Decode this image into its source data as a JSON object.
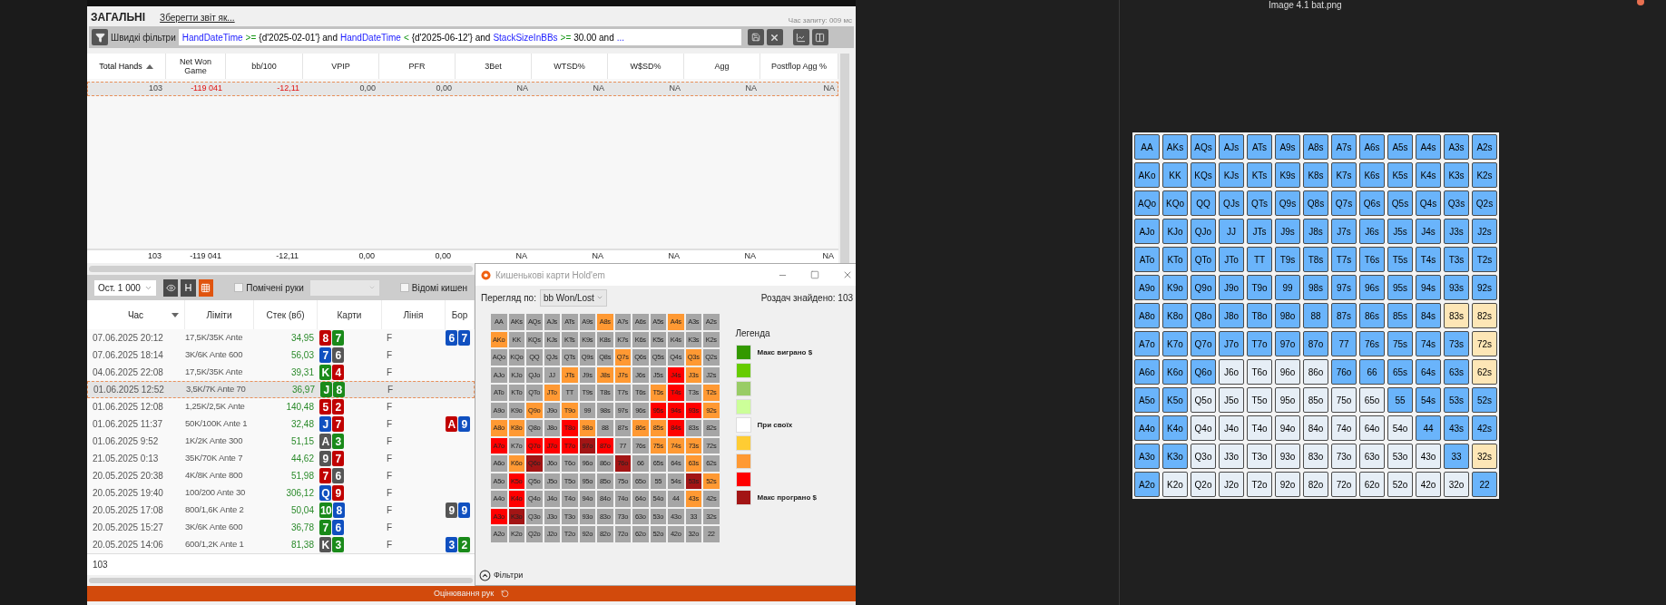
{
  "viewer": {
    "title": "Image 4.1 bat.png"
  },
  "report": {
    "title": "ЗАГАЛЬНІ",
    "save_link": "Зберегти звіт як...",
    "query_time": "Час запиту: 009 мс",
    "quick_filters": {
      "label": "Швидкі фільтри",
      "query": [
        {
          "kind": "field",
          "text": "HandDateTime"
        },
        {
          "kind": "op",
          "text": ">="
        },
        {
          "kind": "text",
          "text": "{d'2025-02-01'} and"
        },
        {
          "kind": "field",
          "text": "HandDateTime"
        },
        {
          "kind": "op",
          "text": "<"
        },
        {
          "kind": "text",
          "text": "{d'2025-06-12'} and"
        },
        {
          "kind": "field",
          "text": "StackSizeInBBs"
        },
        {
          "kind": "op",
          "text": ">="
        },
        {
          "kind": "text",
          "text": "30.00 and"
        },
        {
          "kind": "field",
          "text": "..."
        }
      ]
    },
    "stats": {
      "columns": [
        {
          "label": "Total Hands",
          "sorted": true
        },
        {
          "label": "Net Won Game",
          "sorted": false
        },
        {
          "label": "bb/100",
          "sorted": false
        },
        {
          "label": "VPIP",
          "sorted": false
        },
        {
          "label": "PFR",
          "sorted": false
        },
        {
          "label": "3Bet",
          "sorted": false
        },
        {
          "label": "WTSD%",
          "sorted": false
        },
        {
          "label": "W$SD%",
          "sorted": false
        },
        {
          "label": "Agg",
          "sorted": false
        },
        {
          "label": "Postflop Agg %",
          "sorted": false
        }
      ],
      "rows": [
        {
          "selected": true,
          "cells": [
            {
              "text": "103",
              "negative": false
            },
            {
              "text": "-119 041",
              "negative": true
            },
            {
              "text": "-12,11",
              "negative": true
            },
            {
              "text": "0,00",
              "negative": false
            },
            {
              "text": "0,00",
              "negative": false
            },
            {
              "text": "NA",
              "negative": false
            },
            {
              "text": "NA",
              "negative": false
            },
            {
              "text": "NA",
              "negative": false
            },
            {
              "text": "NA",
              "negative": false
            },
            {
              "text": "NA",
              "negative": false
            }
          ]
        }
      ],
      "total": [
        "103",
        "-119 041",
        "-12,11",
        "0,00",
        "0,00",
        "NA",
        "NA",
        "NA",
        "NA",
        "NA"
      ]
    }
  },
  "hands": {
    "range": "Ост. 1 000",
    "h_button": "H",
    "grid_active": true,
    "checkboxes": [
      {
        "label": "Помічені руки",
        "checked": false
      },
      {
        "label": "Відомі кишен",
        "checked": false
      }
    ],
    "columns": [
      {
        "label": "Час",
        "sorted": true
      },
      {
        "label": "Ліміти",
        "sorted": false
      },
      {
        "label": "Стек (вб)",
        "sorted": false
      },
      {
        "label": "Карти",
        "sorted": false
      },
      {
        "label": "Лінія",
        "sorted": false
      },
      {
        "label": "Бор",
        "sorted": false
      }
    ],
    "rows": [
      {
        "time": "07.06.2025 20:12",
        "limits": "17,5K/35K Ante",
        "stack": "34,95",
        "cards": [
          {
            "rank": "8",
            "color": "#c00000"
          },
          {
            "rank": "7",
            "color": "#1a8a1a"
          }
        ],
        "line": "F",
        "board": [
          {
            "rank": "6",
            "color": "#1050c0"
          },
          {
            "rank": "7",
            "color": "#1050c0"
          }
        ],
        "selected": false
      },
      {
        "time": "07.06.2025 18:14",
        "limits": "3K/6K Ante 600",
        "stack": "56,03",
        "cards": [
          {
            "rank": "7",
            "color": "#1050c0"
          },
          {
            "rank": "6",
            "color": "#555555"
          }
        ],
        "line": "F",
        "board": [],
        "selected": false
      },
      {
        "time": "04.06.2025 22:08",
        "limits": "17,5K/35K Ante",
        "stack": "39,31",
        "cards": [
          {
            "rank": "K",
            "color": "#1a8a1a"
          },
          {
            "rank": "4",
            "color": "#c00000"
          }
        ],
        "line": "F",
        "board": [],
        "selected": false
      },
      {
        "time": "01.06.2025 12:52",
        "limits": "3,5K/7K Ante 70",
        "stack": "36,97",
        "cards": [
          {
            "rank": "J",
            "color": "#1a8a1a"
          },
          {
            "rank": "8",
            "color": "#1a8a1a"
          }
        ],
        "line": "F",
        "board": [],
        "selected": true
      },
      {
        "time": "01.06.2025 12:08",
        "limits": "1,25K/2,5K Ante",
        "stack": "140,48",
        "cards": [
          {
            "rank": "5",
            "color": "#c00000"
          },
          {
            "rank": "2",
            "color": "#c00000"
          }
        ],
        "line": "F",
        "board": [],
        "selected": false
      },
      {
        "time": "01.06.2025 11:37",
        "limits": "50K/100K Ante 1",
        "stack": "32,48",
        "cards": [
          {
            "rank": "J",
            "color": "#1050c0"
          },
          {
            "rank": "7",
            "color": "#c00000"
          }
        ],
        "line": "F",
        "board": [
          {
            "rank": "A",
            "color": "#c00000"
          },
          {
            "rank": "9",
            "color": "#1050c0"
          }
        ],
        "selected": false
      },
      {
        "time": "01.06.2025 9:52",
        "limits": "1K/2K Ante 300",
        "stack": "51,15",
        "cards": [
          {
            "rank": "A",
            "color": "#555555"
          },
          {
            "rank": "3",
            "color": "#1a8a1a"
          }
        ],
        "line": "F",
        "board": [],
        "selected": false
      },
      {
        "time": "21.05.2025 0:13",
        "limits": "35K/70K Ante 7",
        "stack": "44,62",
        "cards": [
          {
            "rank": "9",
            "color": "#555555"
          },
          {
            "rank": "7",
            "color": "#c00000"
          }
        ],
        "line": "F",
        "board": [],
        "selected": false
      },
      {
        "time": "20.05.2025 20:38",
        "limits": "4K/8K Ante 800",
        "stack": "51,98",
        "cards": [
          {
            "rank": "7",
            "color": "#c00000"
          },
          {
            "rank": "6",
            "color": "#555555"
          }
        ],
        "line": "F",
        "board": [],
        "selected": false
      },
      {
        "time": "20.05.2025 19:40",
        "limits": "100/200 Ante 30",
        "stack": "306,12",
        "cards": [
          {
            "rank": "Q",
            "color": "#1050c0"
          },
          {
            "rank": "9",
            "color": "#c00000"
          }
        ],
        "line": "F",
        "board": [],
        "selected": false
      },
      {
        "time": "20.05.2025 17:08",
        "limits": "800/1,6K Ante 2",
        "stack": "50,04",
        "cards": [
          {
            "rank": "10",
            "color": "#1a8a1a"
          },
          {
            "rank": "8",
            "color": "#1050c0"
          }
        ],
        "line": "F",
        "board": [
          {
            "rank": "9",
            "color": "#555555"
          },
          {
            "rank": "9",
            "color": "#1050c0"
          }
        ],
        "selected": false
      },
      {
        "time": "20.05.2025 15:27",
        "limits": "3K/6K Ante 600",
        "stack": "36,78",
        "cards": [
          {
            "rank": "7",
            "color": "#1a8a1a"
          },
          {
            "rank": "6",
            "color": "#1050c0"
          }
        ],
        "line": "F",
        "board": [],
        "selected": false
      },
      {
        "time": "20.05.2025 14:06",
        "limits": "600/1,2K Ante 1",
        "stack": "81,38",
        "cards": [
          {
            "rank": "K",
            "color": "#555555"
          },
          {
            "rank": "3",
            "color": "#1a8a1a"
          }
        ],
        "line": "F",
        "board": [
          {
            "rank": "3",
            "color": "#1050c0"
          },
          {
            "rank": "2",
            "color": "#1a8a1a"
          }
        ],
        "selected": false
      }
    ],
    "count": "103",
    "bottom_button": "Оцінювання рук"
  },
  "popup": {
    "title": "Кишенькові карти Hold'em",
    "view_by": "Перегляд по:",
    "view_value": "bb Won/Lost",
    "found": "Роздач знайдено: 103",
    "legend_title": "Легенда",
    "filters": "Фільтри",
    "legend": [
      {
        "color": "#339900",
        "label": "Макс виграно $"
      },
      {
        "color": "#66cc00"
      },
      {
        "color": "#99cc66"
      },
      {
        "color": "#ccff99"
      },
      {
        "color": "#ffffff",
        "label": "При своїх"
      },
      {
        "color": "#ffcc33"
      },
      {
        "color": "#ff9933"
      },
      {
        "color": "#ff0000"
      },
      {
        "color": "#a31515",
        "label": "Макс програно $"
      }
    ],
    "rows": [
      {
        "cells": [
          {
            "label": "AA",
            "color": "#a6a6a6"
          },
          {
            "label": "AKs",
            "color": "#a6a6a6"
          },
          {
            "label": "AQs",
            "color": "#a6a6a6"
          },
          {
            "label": "AJs",
            "color": "#a6a6a6"
          },
          {
            "label": "ATs",
            "color": "#a6a6a6"
          },
          {
            "label": "A9s",
            "color": "#a6a6a6"
          },
          {
            "label": "A8s",
            "color": "#ff9933"
          },
          {
            "label": "A7s",
            "color": "#a6a6a6"
          },
          {
            "label": "A6s",
            "color": "#a6a6a6"
          },
          {
            "label": "A5s",
            "color": "#a6a6a6"
          },
          {
            "label": "A4s",
            "color": "#ff9933"
          },
          {
            "label": "A3s",
            "color": "#a6a6a6"
          },
          {
            "label": "A2s",
            "color": "#a6a6a6"
          }
        ]
      },
      {
        "cells": [
          {
            "label": "AKo",
            "color": "#ff9933"
          },
          {
            "label": "KK",
            "color": "#a6a6a6"
          },
          {
            "label": "KQs",
            "color": "#a6a6a6"
          },
          {
            "label": "KJs",
            "color": "#a6a6a6"
          },
          {
            "label": "KTs",
            "color": "#a6a6a6"
          },
          {
            "label": "K9s",
            "color": "#a6a6a6"
          },
          {
            "label": "K8s",
            "color": "#a6a6a6"
          },
          {
            "label": "K7s",
            "color": "#a6a6a6"
          },
          {
            "label": "K6s",
            "color": "#a6a6a6"
          },
          {
            "label": "K5s",
            "color": "#a6a6a6"
          },
          {
            "label": "K4s",
            "color": "#a6a6a6"
          },
          {
            "label": "K3s",
            "color": "#a6a6a6"
          },
          {
            "label": "K2s",
            "color": "#a6a6a6"
          }
        ]
      },
      {
        "cells": [
          {
            "label": "AQo",
            "color": "#a6a6a6"
          },
          {
            "label": "KQo",
            "color": "#a6a6a6"
          },
          {
            "label": "QQ",
            "color": "#a6a6a6"
          },
          {
            "label": "QJs",
            "color": "#a6a6a6"
          },
          {
            "label": "QTs",
            "color": "#a6a6a6"
          },
          {
            "label": "Q9s",
            "color": "#a6a6a6"
          },
          {
            "label": "Q8s",
            "color": "#a6a6a6"
          },
          {
            "label": "Q7s",
            "color": "#ff9933"
          },
          {
            "label": "Q6s",
            "color": "#a6a6a6"
          },
          {
            "label": "Q5s",
            "color": "#a6a6a6"
          },
          {
            "label": "Q4s",
            "color": "#a6a6a6"
          },
          {
            "label": "Q3s",
            "color": "#ff9933"
          },
          {
            "label": "Q2s",
            "color": "#a6a6a6"
          }
        ]
      },
      {
        "cells": [
          {
            "label": "AJo",
            "color": "#a6a6a6"
          },
          {
            "label": "KJo",
            "color": "#a6a6a6"
          },
          {
            "label": "QJo",
            "color": "#a6a6a6"
          },
          {
            "label": "JJ",
            "color": "#a6a6a6"
          },
          {
            "label": "JTs",
            "color": "#ff9933"
          },
          {
            "label": "J9s",
            "color": "#a6a6a6"
          },
          {
            "label": "J8s",
            "color": "#ff9933"
          },
          {
            "label": "J7s",
            "color": "#ff9933"
          },
          {
            "label": "J6s",
            "color": "#a6a6a6"
          },
          {
            "label": "J5s",
            "color": "#a6a6a6"
          },
          {
            "label": "J4s",
            "color": "#ff0000"
          },
          {
            "label": "J3s",
            "color": "#ff9933"
          },
          {
            "label": "J2s",
            "color": "#a6a6a6"
          }
        ]
      },
      {
        "cells": [
          {
            "label": "ATo",
            "color": "#a6a6a6"
          },
          {
            "label": "KTo",
            "color": "#a6a6a6"
          },
          {
            "label": "QTo",
            "color": "#a6a6a6"
          },
          {
            "label": "JTo",
            "color": "#ff9933"
          },
          {
            "label": "TT",
            "color": "#a6a6a6"
          },
          {
            "label": "T9s",
            "color": "#a6a6a6"
          },
          {
            "label": "T8s",
            "color": "#a6a6a6"
          },
          {
            "label": "T7s",
            "color": "#a6a6a6"
          },
          {
            "label": "T6s",
            "color": "#a6a6a6"
          },
          {
            "label": "T5s",
            "color": "#ff9933"
          },
          {
            "label": "T4s",
            "color": "#ff0000"
          },
          {
            "label": "T3s",
            "color": "#a6a6a6"
          },
          {
            "label": "T2s",
            "color": "#ff9933"
          }
        ]
      },
      {
        "cells": [
          {
            "label": "A9o",
            "color": "#a6a6a6"
          },
          {
            "label": "K9o",
            "color": "#a6a6a6"
          },
          {
            "label": "Q9o",
            "color": "#ff9933"
          },
          {
            "label": "J9o",
            "color": "#a6a6a6"
          },
          {
            "label": "T9o",
            "color": "#ff9933"
          },
          {
            "label": "99",
            "color": "#a6a6a6"
          },
          {
            "label": "98s",
            "color": "#a6a6a6"
          },
          {
            "label": "97s",
            "color": "#a6a6a6"
          },
          {
            "label": "96s",
            "color": "#a6a6a6"
          },
          {
            "label": "95s",
            "color": "#ff0000"
          },
          {
            "label": "94s",
            "color": "#ff0000"
          },
          {
            "label": "93s",
            "color": "#ff0000"
          },
          {
            "label": "92s",
            "color": "#ff9933"
          }
        ]
      },
      {
        "cells": [
          {
            "label": "A8o",
            "color": "#ff9933"
          },
          {
            "label": "K8o",
            "color": "#ff9933"
          },
          {
            "label": "Q8o",
            "color": "#a6a6a6"
          },
          {
            "label": "J8o",
            "color": "#a6a6a6"
          },
          {
            "label": "T8o",
            "color": "#ff0000"
          },
          {
            "label": "98o",
            "color": "#ff9933"
          },
          {
            "label": "88",
            "color": "#a6a6a6"
          },
          {
            "label": "87s",
            "color": "#a6a6a6"
          },
          {
            "label": "86s",
            "color": "#ff9933"
          },
          {
            "label": "85s",
            "color": "#ff9933"
          },
          {
            "label": "84s",
            "color": "#ff0000"
          },
          {
            "label": "83s",
            "color": "#a6a6a6"
          },
          {
            "label": "82s",
            "color": "#a6a6a6"
          }
        ]
      },
      {
        "cells": [
          {
            "label": "A7o",
            "color": "#ff0000"
          },
          {
            "label": "K7o",
            "color": "#a6a6a6"
          },
          {
            "label": "Q7o",
            "color": "#ff0000"
          },
          {
            "label": "J7o",
            "color": "#ff0000"
          },
          {
            "label": "T7o",
            "color": "#ff0000"
          },
          {
            "label": "97o",
            "color": "#a31515"
          },
          {
            "label": "87o",
            "color": "#ff0000"
          },
          {
            "label": "77",
            "color": "#a6a6a6"
          },
          {
            "label": "76s",
            "color": "#a6a6a6"
          },
          {
            "label": "75s",
            "color": "#ff9933"
          },
          {
            "label": "74s",
            "color": "#ff9933"
          },
          {
            "label": "73s",
            "color": "#ff9933"
          },
          {
            "label": "72s",
            "color": "#a6a6a6"
          }
        ]
      },
      {
        "cells": [
          {
            "label": "A6o",
            "color": "#a6a6a6"
          },
          {
            "label": "K6o",
            "color": "#ff9933"
          },
          {
            "label": "Q6o",
            "color": "#a31515"
          },
          {
            "label": "J6o",
            "color": "#a6a6a6"
          },
          {
            "label": "T6o",
            "color": "#a6a6a6"
          },
          {
            "label": "96o",
            "color": "#a6a6a6"
          },
          {
            "label": "86o",
            "color": "#a6a6a6"
          },
          {
            "label": "76o",
            "color": "#a31515"
          },
          {
            "label": "66",
            "color": "#a6a6a6"
          },
          {
            "label": "65s",
            "color": "#a6a6a6"
          },
          {
            "label": "64s",
            "color": "#a6a6a6"
          },
          {
            "label": "63s",
            "color": "#ff9933"
          },
          {
            "label": "62s",
            "color": "#a6a6a6"
          }
        ]
      },
      {
        "cells": [
          {
            "label": "A5o",
            "color": "#a6a6a6"
          },
          {
            "label": "K5o",
            "color": "#ff0000"
          },
          {
            "label": "Q5o",
            "color": "#a6a6a6"
          },
          {
            "label": "J5o",
            "color": "#a6a6a6"
          },
          {
            "label": "T5o",
            "color": "#a6a6a6"
          },
          {
            "label": "95o",
            "color": "#a6a6a6"
          },
          {
            "label": "85o",
            "color": "#a6a6a6"
          },
          {
            "label": "75o",
            "color": "#a6a6a6"
          },
          {
            "label": "65o",
            "color": "#a6a6a6"
          },
          {
            "label": "55",
            "color": "#a6a6a6"
          },
          {
            "label": "54s",
            "color": "#a6a6a6"
          },
          {
            "label": "53s",
            "color": "#a31515"
          },
          {
            "label": "52s",
            "color": "#ff9933"
          }
        ]
      },
      {
        "cells": [
          {
            "label": "A4o",
            "color": "#a6a6a6"
          },
          {
            "label": "K4o",
            "color": "#ff0000"
          },
          {
            "label": "Q4o",
            "color": "#a6a6a6"
          },
          {
            "label": "J4o",
            "color": "#a6a6a6"
          },
          {
            "label": "T4o",
            "color": "#a6a6a6"
          },
          {
            "label": "94o",
            "color": "#a6a6a6"
          },
          {
            "label": "84o",
            "color": "#a6a6a6"
          },
          {
            "label": "74o",
            "color": "#a6a6a6"
          },
          {
            "label": "64o",
            "color": "#a6a6a6"
          },
          {
            "label": "54o",
            "color": "#a6a6a6"
          },
          {
            "label": "44",
            "color": "#a6a6a6"
          },
          {
            "label": "43s",
            "color": "#ff9933"
          },
          {
            "label": "42s",
            "color": "#a6a6a6"
          }
        ]
      },
      {
        "cells": [
          {
            "label": "A3o",
            "color": "#ff0000"
          },
          {
            "label": "K3o",
            "color": "#a31515"
          },
          {
            "label": "Q3o",
            "color": "#a6a6a6"
          },
          {
            "label": "J3o",
            "color": "#a6a6a6"
          },
          {
            "label": "T3o",
            "color": "#a6a6a6"
          },
          {
            "label": "93o",
            "color": "#a6a6a6"
          },
          {
            "label": "83o",
            "color": "#a6a6a6"
          },
          {
            "label": "73o",
            "color": "#a6a6a6"
          },
          {
            "label": "63o",
            "color": "#a6a6a6"
          },
          {
            "label": "53o",
            "color": "#a6a6a6"
          },
          {
            "label": "43o",
            "color": "#a6a6a6"
          },
          {
            "label": "33",
            "color": "#a6a6a6"
          },
          {
            "label": "32s",
            "color": "#a6a6a6"
          }
        ]
      },
      {
        "cells": [
          {
            "label": "A2o",
            "color": "#a6a6a6"
          },
          {
            "label": "K2o",
            "color": "#a6a6a6"
          },
          {
            "label": "Q2o",
            "color": "#a6a6a6"
          },
          {
            "label": "J2o",
            "color": "#a6a6a6"
          },
          {
            "label": "T2o",
            "color": "#a6a6a6"
          },
          {
            "label": "92o",
            "color": "#a6a6a6"
          },
          {
            "label": "82o",
            "color": "#a6a6a6"
          },
          {
            "label": "72o",
            "color": "#a6a6a6"
          },
          {
            "label": "62o",
            "color": "#a6a6a6"
          },
          {
            "label": "52o",
            "color": "#a6a6a6"
          },
          {
            "label": "42o",
            "color": "#a6a6a6"
          },
          {
            "label": "32o",
            "color": "#a6a6a6"
          },
          {
            "label": "22",
            "color": "#a6a6a6"
          }
        ]
      }
    ]
  },
  "range_chart": {
    "rows": [
      {
        "cells": [
          {
            "label": "AA",
            "color": "#6ab4fb"
          },
          {
            "label": "AKs",
            "color": "#6ab4fb"
          },
          {
            "label": "AQs",
            "color": "#6ab4fb"
          },
          {
            "label": "AJs",
            "color": "#6ab4fb"
          },
          {
            "label": "ATs",
            "color": "#6ab4fb"
          },
          {
            "label": "A9s",
            "color": "#6ab4fb"
          },
          {
            "label": "A8s",
            "color": "#6ab4fb"
          },
          {
            "label": "A7s",
            "color": "#6ab4fb"
          },
          {
            "label": "A6s",
            "color": "#6ab4fb"
          },
          {
            "label": "A5s",
            "color": "#6ab4fb"
          },
          {
            "label": "A4s",
            "color": "#6ab4fb"
          },
          {
            "label": "A3s",
            "color": "#6ab4fb"
          },
          {
            "label": "A2s",
            "color": "#6ab4fb"
          }
        ]
      },
      {
        "cells": [
          {
            "label": "AKo",
            "color": "#6ab4fb"
          },
          {
            "label": "KK",
            "color": "#6ab4fb"
          },
          {
            "label": "KQs",
            "color": "#6ab4fb"
          },
          {
            "label": "KJs",
            "color": "#6ab4fb"
          },
          {
            "label": "KTs",
            "color": "#6ab4fb"
          },
          {
            "label": "K9s",
            "color": "#6ab4fb"
          },
          {
            "label": "K8s",
            "color": "#6ab4fb"
          },
          {
            "label": "K7s",
            "color": "#6ab4fb"
          },
          {
            "label": "K6s",
            "color": "#6ab4fb"
          },
          {
            "label": "K5s",
            "color": "#6ab4fb"
          },
          {
            "label": "K4s",
            "color": "#6ab4fb"
          },
          {
            "label": "K3s",
            "color": "#6ab4fb"
          },
          {
            "label": "K2s",
            "color": "#6ab4fb"
          }
        ]
      },
      {
        "cells": [
          {
            "label": "AQo",
            "color": "#6ab4fb"
          },
          {
            "label": "KQo",
            "color": "#6ab4fb"
          },
          {
            "label": "QQ",
            "color": "#6ab4fb"
          },
          {
            "label": "QJs",
            "color": "#6ab4fb"
          },
          {
            "label": "QTs",
            "color": "#6ab4fb"
          },
          {
            "label": "Q9s",
            "color": "#6ab4fb"
          },
          {
            "label": "Q8s",
            "color": "#6ab4fb"
          },
          {
            "label": "Q7s",
            "color": "#6ab4fb"
          },
          {
            "label": "Q6s",
            "color": "#6ab4fb"
          },
          {
            "label": "Q5s",
            "color": "#6ab4fb"
          },
          {
            "label": "Q4s",
            "color": "#6ab4fb"
          },
          {
            "label": "Q3s",
            "color": "#6ab4fb"
          },
          {
            "label": "Q2s",
            "color": "#6ab4fb"
          }
        ]
      },
      {
        "cells": [
          {
            "label": "AJo",
            "color": "#6ab4fb"
          },
          {
            "label": "KJo",
            "color": "#6ab4fb"
          },
          {
            "label": "QJo",
            "color": "#6ab4fb"
          },
          {
            "label": "JJ",
            "color": "#6ab4fb"
          },
          {
            "label": "JTs",
            "color": "#6ab4fb"
          },
          {
            "label": "J9s",
            "color": "#6ab4fb"
          },
          {
            "label": "J8s",
            "color": "#6ab4fb"
          },
          {
            "label": "J7s",
            "color": "#6ab4fb"
          },
          {
            "label": "J6s",
            "color": "#6ab4fb"
          },
          {
            "label": "J5s",
            "color": "#6ab4fb"
          },
          {
            "label": "J4s",
            "color": "#6ab4fb"
          },
          {
            "label": "J3s",
            "color": "#6ab4fb"
          },
          {
            "label": "J2s",
            "color": "#6ab4fb"
          }
        ]
      },
      {
        "cells": [
          {
            "label": "ATo",
            "color": "#6ab4fb"
          },
          {
            "label": "KTo",
            "color": "#6ab4fb"
          },
          {
            "label": "QTo",
            "color": "#6ab4fb"
          },
          {
            "label": "JTo",
            "color": "#6ab4fb"
          },
          {
            "label": "TT",
            "color": "#6ab4fb"
          },
          {
            "label": "T9s",
            "color": "#6ab4fb"
          },
          {
            "label": "T8s",
            "color": "#6ab4fb"
          },
          {
            "label": "T7s",
            "color": "#6ab4fb"
          },
          {
            "label": "T6s",
            "color": "#6ab4fb"
          },
          {
            "label": "T5s",
            "color": "#6ab4fb"
          },
          {
            "label": "T4s",
            "color": "#6ab4fb"
          },
          {
            "label": "T3s",
            "color": "#6ab4fb"
          },
          {
            "label": "T2s",
            "color": "#6ab4fb"
          }
        ]
      },
      {
        "cells": [
          {
            "label": "A9o",
            "color": "#6ab4fb"
          },
          {
            "label": "K9o",
            "color": "#6ab4fb"
          },
          {
            "label": "Q9o",
            "color": "#6ab4fb"
          },
          {
            "label": "J9o",
            "color": "#6ab4fb"
          },
          {
            "label": "T9o",
            "color": "#6ab4fb"
          },
          {
            "label": "99",
            "color": "#6ab4fb"
          },
          {
            "label": "98s",
            "color": "#6ab4fb"
          },
          {
            "label": "97s",
            "color": "#6ab4fb"
          },
          {
            "label": "96s",
            "color": "#6ab4fb"
          },
          {
            "label": "95s",
            "color": "#6ab4fb"
          },
          {
            "label": "94s",
            "color": "#6ab4fb"
          },
          {
            "label": "93s",
            "color": "#6ab4fb"
          },
          {
            "label": "92s",
            "color": "#6ab4fb"
          }
        ]
      },
      {
        "cells": [
          {
            "label": "A8o",
            "color": "#6ab4fb"
          },
          {
            "label": "K8o",
            "color": "#6ab4fb"
          },
          {
            "label": "Q8o",
            "color": "#6ab4fb"
          },
          {
            "label": "J8o",
            "color": "#6ab4fb"
          },
          {
            "label": "T8o",
            "color": "#6ab4fb"
          },
          {
            "label": "98o",
            "color": "#6ab4fb"
          },
          {
            "label": "88",
            "color": "#6ab4fb"
          },
          {
            "label": "87s",
            "color": "#6ab4fb"
          },
          {
            "label": "86s",
            "color": "#6ab4fb"
          },
          {
            "label": "85s",
            "color": "#6ab4fb"
          },
          {
            "label": "84s",
            "color": "#6ab4fb"
          },
          {
            "label": "83s",
            "color": "#fde6b6"
          },
          {
            "label": "82s",
            "color": "#fde6b6"
          }
        ]
      },
      {
        "cells": [
          {
            "label": "A7o",
            "color": "#6ab4fb"
          },
          {
            "label": "K7o",
            "color": "#6ab4fb"
          },
          {
            "label": "Q7o",
            "color": "#6ab4fb"
          },
          {
            "label": "J7o",
            "color": "#6ab4fb"
          },
          {
            "label": "T7o",
            "color": "#6ab4fb"
          },
          {
            "label": "97o",
            "color": "#6ab4fb"
          },
          {
            "label": "87o",
            "color": "#6ab4fb"
          },
          {
            "label": "77",
            "color": "#6ab4fb"
          },
          {
            "label": "76s",
            "color": "#6ab4fb"
          },
          {
            "label": "75s",
            "color": "#6ab4fb"
          },
          {
            "label": "74s",
            "color": "#6ab4fb"
          },
          {
            "label": "73s",
            "color": "#6ab4fb"
          },
          {
            "label": "72s",
            "color": "#fde6b6"
          }
        ]
      },
      {
        "cells": [
          {
            "label": "A6o",
            "color": "#6ab4fb"
          },
          {
            "label": "K6o",
            "color": "#6ab4fb"
          },
          {
            "label": "Q6o",
            "color": "#6ab4fb"
          },
          {
            "label": "J6o",
            "color": "#e6eef6"
          },
          {
            "label": "T6o",
            "color": "#e6eef6"
          },
          {
            "label": "96o",
            "color": "#e6eef6"
          },
          {
            "label": "86o",
            "color": "#e6eef6"
          },
          {
            "label": "76o",
            "color": "#6ab4fb"
          },
          {
            "label": "66",
            "color": "#6ab4fb"
          },
          {
            "label": "65s",
            "color": "#6ab4fb"
          },
          {
            "label": "64s",
            "color": "#6ab4fb"
          },
          {
            "label": "63s",
            "color": "#6ab4fb"
          },
          {
            "label": "62s",
            "color": "#fde6b6"
          }
        ]
      },
      {
        "cells": [
          {
            "label": "A5o",
            "color": "#6ab4fb"
          },
          {
            "label": "K5o",
            "color": "#6ab4fb"
          },
          {
            "label": "Q5o",
            "color": "#e6eef6"
          },
          {
            "label": "J5o",
            "color": "#e6eef6"
          },
          {
            "label": "T5o",
            "color": "#e6eef6"
          },
          {
            "label": "95o",
            "color": "#e6eef6"
          },
          {
            "label": "85o",
            "color": "#e6eef6"
          },
          {
            "label": "75o",
            "color": "#e6eef6"
          },
          {
            "label": "65o",
            "color": "#e6eef6"
          },
          {
            "label": "55",
            "color": "#6ab4fb"
          },
          {
            "label": "54s",
            "color": "#6ab4fb"
          },
          {
            "label": "53s",
            "color": "#6ab4fb"
          },
          {
            "label": "52s",
            "color": "#6ab4fb"
          }
        ]
      },
      {
        "cells": [
          {
            "label": "A4o",
            "color": "#6ab4fb"
          },
          {
            "label": "K4o",
            "color": "#6ab4fb"
          },
          {
            "label": "Q4o",
            "color": "#e6eef6"
          },
          {
            "label": "J4o",
            "color": "#e6eef6"
          },
          {
            "label": "T4o",
            "color": "#e6eef6"
          },
          {
            "label": "94o",
            "color": "#e6eef6"
          },
          {
            "label": "84o",
            "color": "#e6eef6"
          },
          {
            "label": "74o",
            "color": "#e6eef6"
          },
          {
            "label": "64o",
            "color": "#e6eef6"
          },
          {
            "label": "54o",
            "color": "#e6eef6"
          },
          {
            "label": "44",
            "color": "#6ab4fb"
          },
          {
            "label": "43s",
            "color": "#6ab4fb"
          },
          {
            "label": "42s",
            "color": "#6ab4fb"
          }
        ]
      },
      {
        "cells": [
          {
            "label": "A3o",
            "color": "#6ab4fb"
          },
          {
            "label": "K3o",
            "color": "#6ab4fb"
          },
          {
            "label": "Q3o",
            "color": "#e6eef6"
          },
          {
            "label": "J3o",
            "color": "#e6eef6"
          },
          {
            "label": "T3o",
            "color": "#e6eef6"
          },
          {
            "label": "93o",
            "color": "#e6eef6"
          },
          {
            "label": "83o",
            "color": "#e6eef6"
          },
          {
            "label": "73o",
            "color": "#e6eef6"
          },
          {
            "label": "63o",
            "color": "#e6eef6"
          },
          {
            "label": "53o",
            "color": "#e6eef6"
          },
          {
            "label": "43o",
            "color": "#e6eef6"
          },
          {
            "label": "33",
            "color": "#6ab4fb"
          },
          {
            "label": "32s",
            "color": "#fde6b6"
          }
        ]
      },
      {
        "cells": [
          {
            "label": "A2o",
            "color": "#6ab4fb"
          },
          {
            "label": "K2o",
            "color": "#e6eef6"
          },
          {
            "label": "Q2o",
            "color": "#e6eef6"
          },
          {
            "label": "J2o",
            "color": "#e6eef6"
          },
          {
            "label": "T2o",
            "color": "#e6eef6"
          },
          {
            "label": "92o",
            "color": "#e6eef6"
          },
          {
            "label": "82o",
            "color": "#e6eef6"
          },
          {
            "label": "72o",
            "color": "#e6eef6"
          },
          {
            "label": "62o",
            "color": "#e6eef6"
          },
          {
            "label": "52o",
            "color": "#e6eef6"
          },
          {
            "label": "42o",
            "color": "#e6eef6"
          },
          {
            "label": "32o",
            "color": "#e6eef6"
          },
          {
            "label": "22",
            "color": "#6ab4fb"
          }
        ]
      }
    ]
  }
}
